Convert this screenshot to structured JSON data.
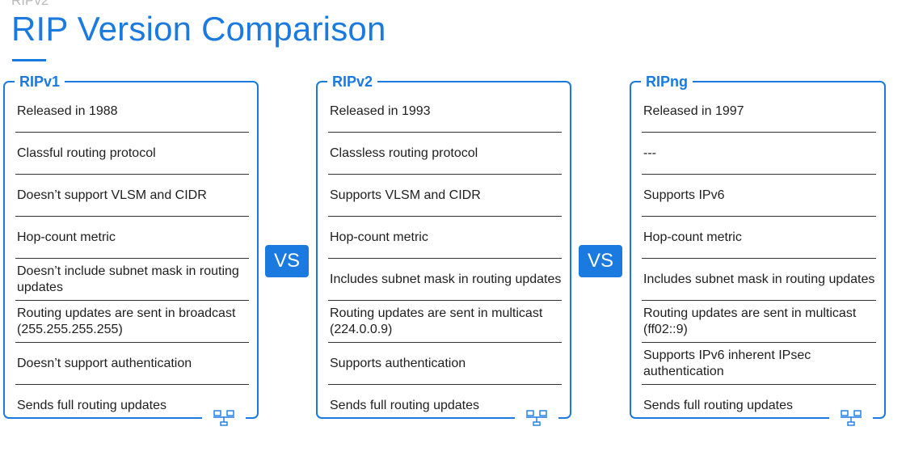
{
  "header": {
    "kicker": "RIPv2",
    "title": "RIP Version Comparison"
  },
  "vs_label": "VS",
  "columns": [
    {
      "name": "RIPv1",
      "rows": [
        "Released in 1988",
        "Classful routing protocol",
        "Doesn’t support VLSM and CIDR",
        "Hop-count metric",
        "Doesn’t include subnet mask in routing updates",
        "Routing updates are sent in broadcast (255.255.255.255)",
        "Doesn’t support authentication",
        "Sends full routing updates"
      ]
    },
    {
      "name": "RIPv2",
      "rows": [
        "Released in 1993",
        "Classless routing protocol",
        "Supports VLSM and CIDR",
        "Hop-count metric",
        "Includes subnet mask in routing updates",
        "Routing updates are sent in multicast (224.0.0.9)",
        "Supports authentication",
        "Sends full routing updates"
      ]
    },
    {
      "name": "RIPng",
      "rows": [
        "Released in 1997",
        "---",
        "Supports IPv6",
        "Hop-count metric",
        "Includes subnet mask in routing updates",
        "Routing updates are sent in multicast (ff02::9)",
        "Supports IPv6 inherent IPsec authentication",
        "Sends full routing updates"
      ]
    }
  ],
  "colors": {
    "accent": "#1a7ae0",
    "kicker": "#b9b9b9",
    "text": "#1e1e1e"
  },
  "icons": [
    "network-computers-icon"
  ]
}
